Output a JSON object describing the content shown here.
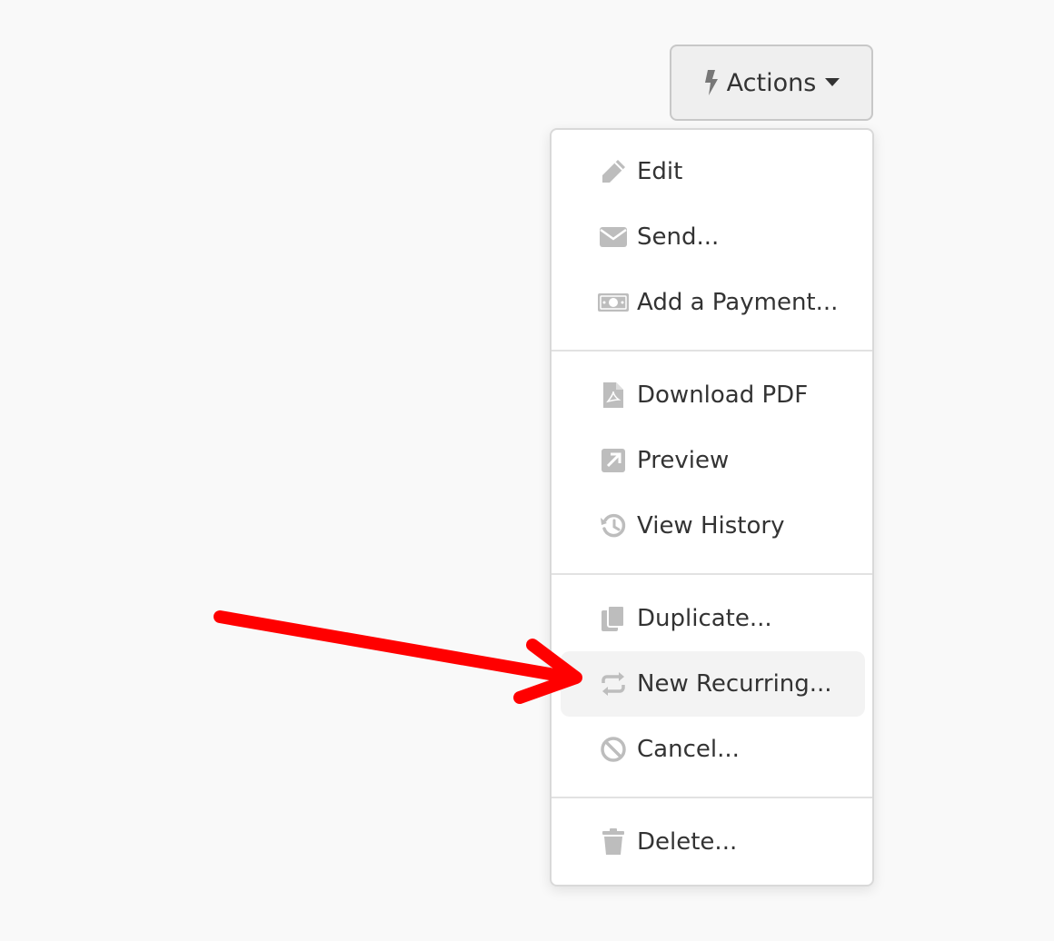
{
  "actions_button": {
    "label": "Actions",
    "icon": "bolt-icon",
    "caret_icon": "caret-down-icon"
  },
  "menu": {
    "groups": [
      {
        "items": [
          {
            "label": "Edit",
            "icon": "pencil-icon"
          },
          {
            "label": "Send...",
            "icon": "envelope-icon"
          },
          {
            "label": "Add a Payment...",
            "icon": "money-icon"
          }
        ]
      },
      {
        "items": [
          {
            "label": "Download PDF",
            "icon": "pdf-file-icon"
          },
          {
            "label": "Preview",
            "icon": "external-link-icon"
          },
          {
            "label": "View History",
            "icon": "history-icon"
          }
        ]
      },
      {
        "items": [
          {
            "label": "Duplicate...",
            "icon": "copy-icon"
          },
          {
            "label": "New Recurring...",
            "icon": "recurring-icon",
            "highlighted": true
          },
          {
            "label": "Cancel...",
            "icon": "ban-icon"
          }
        ]
      },
      {
        "items": [
          {
            "label": "Delete...",
            "icon": "trash-icon"
          }
        ]
      }
    ]
  },
  "annotation": {
    "type": "arrow",
    "color": "#ff0000",
    "points_to": "New Recurring..."
  },
  "colors": {
    "background": "#f9f9f9",
    "icon_gray": "#bdbdbd",
    "text": "#333333",
    "hover": "#f3f3f3"
  }
}
